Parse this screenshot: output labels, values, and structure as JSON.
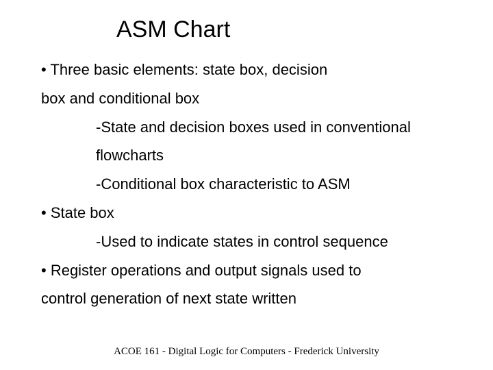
{
  "title": "ASM Chart",
  "body": {
    "line1": "• Three basic elements: state box, decision",
    "line2": "box and conditional box",
    "sub1": "-State and decision boxes used in conventional",
    "sub2": "flowcharts",
    "sub3": "-Conditional box characteristic to ASM",
    "line3": "• State box",
    "sub4": "-Used to indicate states in control sequence",
    "line4": "• Register operations and output signals used to",
    "line5": "control generation of next state written"
  },
  "footer": "ACOE 161 - Digital Logic for Computers - Frederick University"
}
